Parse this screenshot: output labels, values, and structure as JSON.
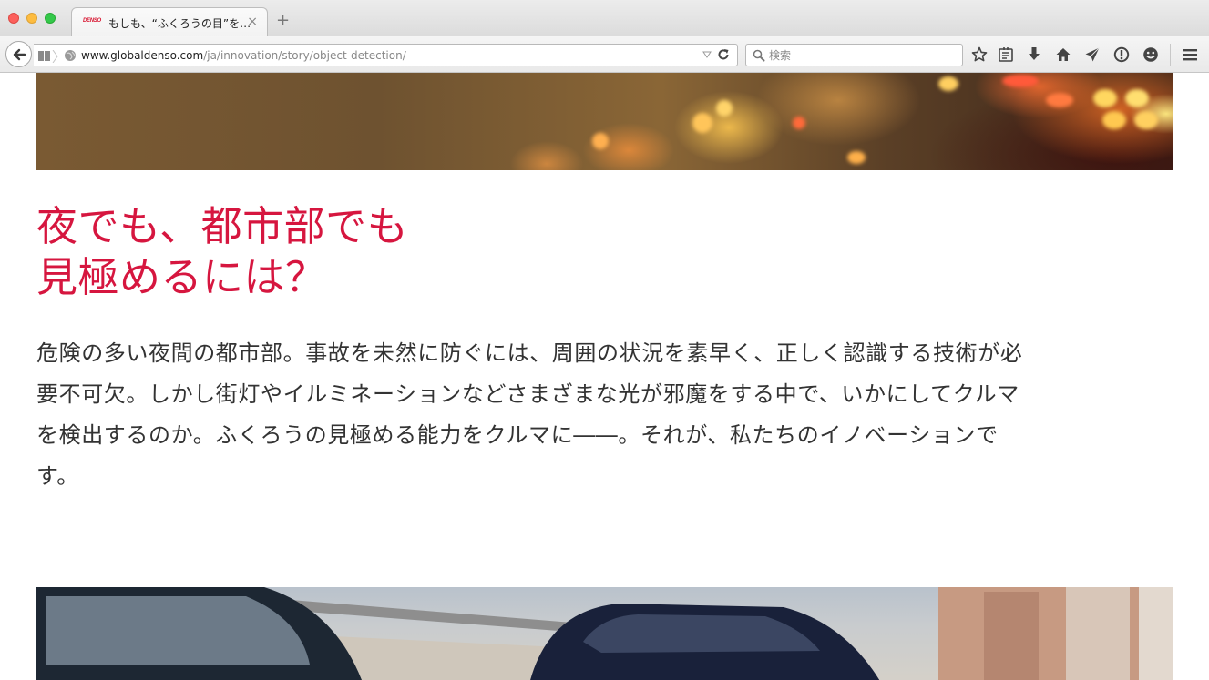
{
  "browser": {
    "tab": {
      "title": "もしも、“ふくろうの目”を…",
      "favicon_text": "DENSO"
    },
    "url": {
      "host": "www.globaldenso.com",
      "path": "/ja/innovation/story/object-detection/"
    },
    "search": {
      "placeholder": "検索"
    },
    "toolbar_icons": [
      "bookmark-star-icon",
      "reading-list-icon",
      "download-icon",
      "home-icon",
      "send-icon",
      "info-icon",
      "smiley-icon",
      "menu-icon"
    ]
  },
  "page": {
    "headline": [
      "夜でも、都市部でも",
      "見極めるには？"
    ],
    "body": [
      "危険の多い夜間の都市部。事故を未然に防ぐには、周囲の状況を素早く、正しく認識する技術が必",
      "要不可欠。しかし街灯やイルミネーションなどさまざまな光が邪魔をする中で、いかにしてクルマ",
      "を検出するのか。ふくろうの見極める能力をクルマに――。それが、私たちのイノベーションで",
      "す。"
    ],
    "colors": {
      "headline": "#d6163f",
      "body": "#333333"
    }
  }
}
